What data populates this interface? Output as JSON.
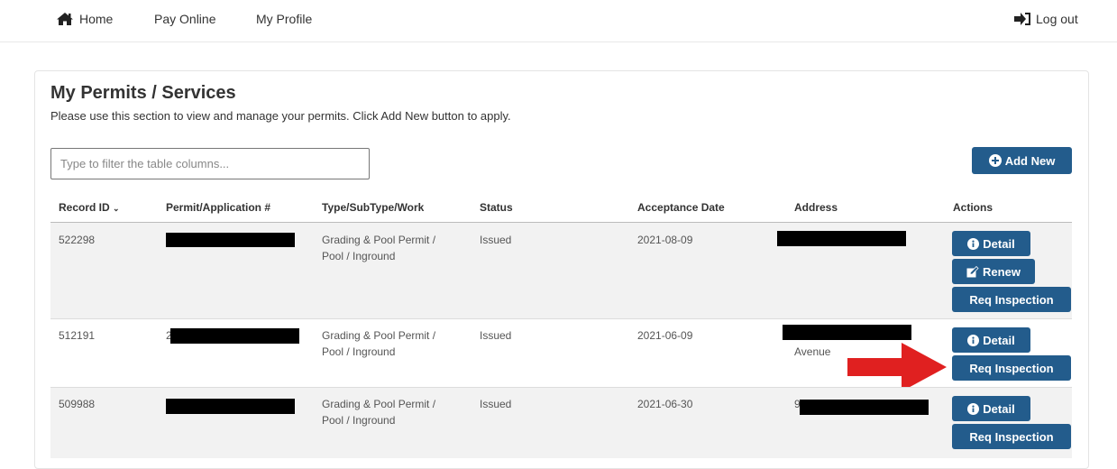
{
  "nav": {
    "home": "Home",
    "pay_online": "Pay Online",
    "my_profile": "My Profile",
    "logout": "Log out"
  },
  "page": {
    "title": "My Permits / Services",
    "description": "Please use this section to view and manage your permits. Click Add New button to apply."
  },
  "filter": {
    "placeholder": "Type to filter the table columns..."
  },
  "add_new_label": "Add New",
  "table": {
    "headers": [
      "Record ID",
      "Permit/Application #",
      "Type/SubType/Work",
      "Status",
      "Acceptance Date",
      "Address",
      "Actions"
    ],
    "rows": [
      {
        "record_id": "522298",
        "permit_no": "",
        "type_line1": "Grading & Pool Permit /",
        "type_line2": "Pool / Inground",
        "status": "Issued",
        "date": "2021-08-09",
        "address": "",
        "actions": [
          "Detail",
          "Renew",
          "Req Inspection"
        ]
      },
      {
        "record_id": "512191",
        "permit_prefix": "2",
        "type_line1": "Grading & Pool Permit /",
        "type_line2": "Pool / Inground",
        "status": "Issued",
        "date": "2021-06-09",
        "address": "Avenue",
        "actions": [
          "Detail",
          "Req Inspection"
        ]
      },
      {
        "record_id": "509988",
        "permit_no": "",
        "type_line1": "Grading & Pool Permit /",
        "type_line2": "Pool / Inground",
        "status": "Issued",
        "date": "2021-06-30",
        "address_prefix": "9",
        "actions": [
          "Detail",
          "Req Inspection"
        ]
      }
    ]
  },
  "colors": {
    "primary_button": "#235c8c",
    "annotation_arrow": "#e02020"
  }
}
